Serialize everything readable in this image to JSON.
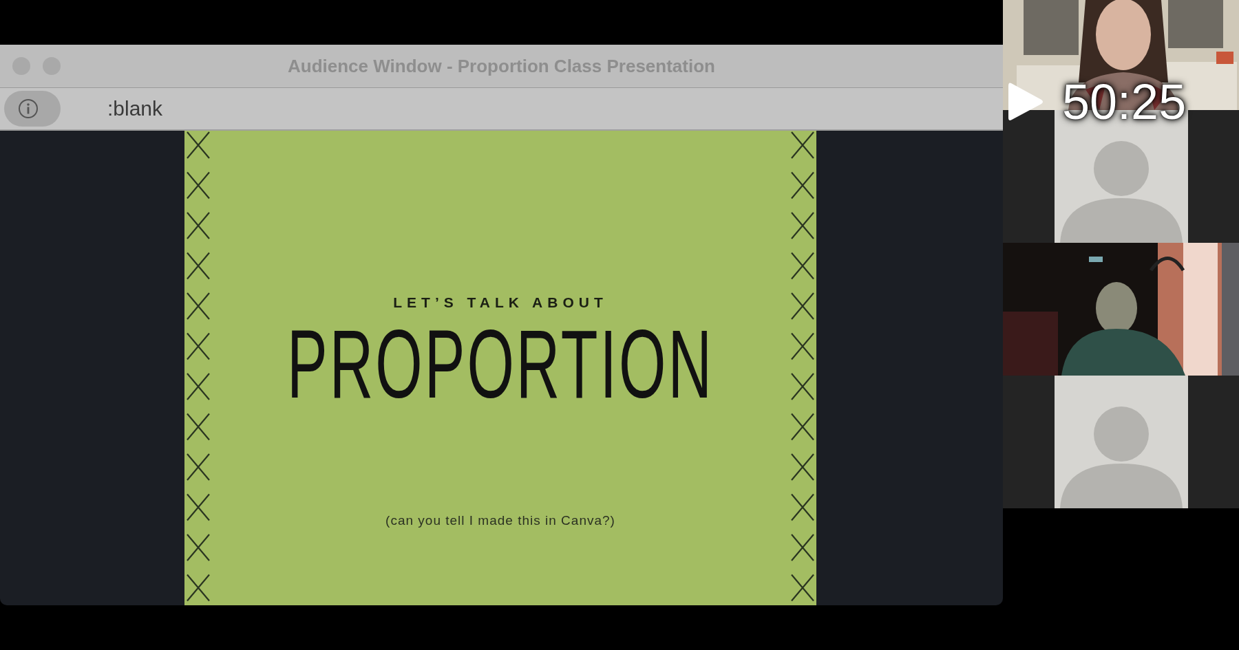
{
  "window": {
    "title": "Audience Window - Proportion Class Presentation",
    "address": ":blank"
  },
  "slide": {
    "kicker": "LET’S TALK ABOUT",
    "title": "PROPORTION",
    "note": "(can you tell I made this in Canva?)"
  },
  "participants": [
    {
      "kind": "picture"
    },
    {
      "kind": "avatar"
    },
    {
      "kind": "picture"
    },
    {
      "kind": "avatar"
    }
  ],
  "player": {
    "time": "50:25"
  }
}
